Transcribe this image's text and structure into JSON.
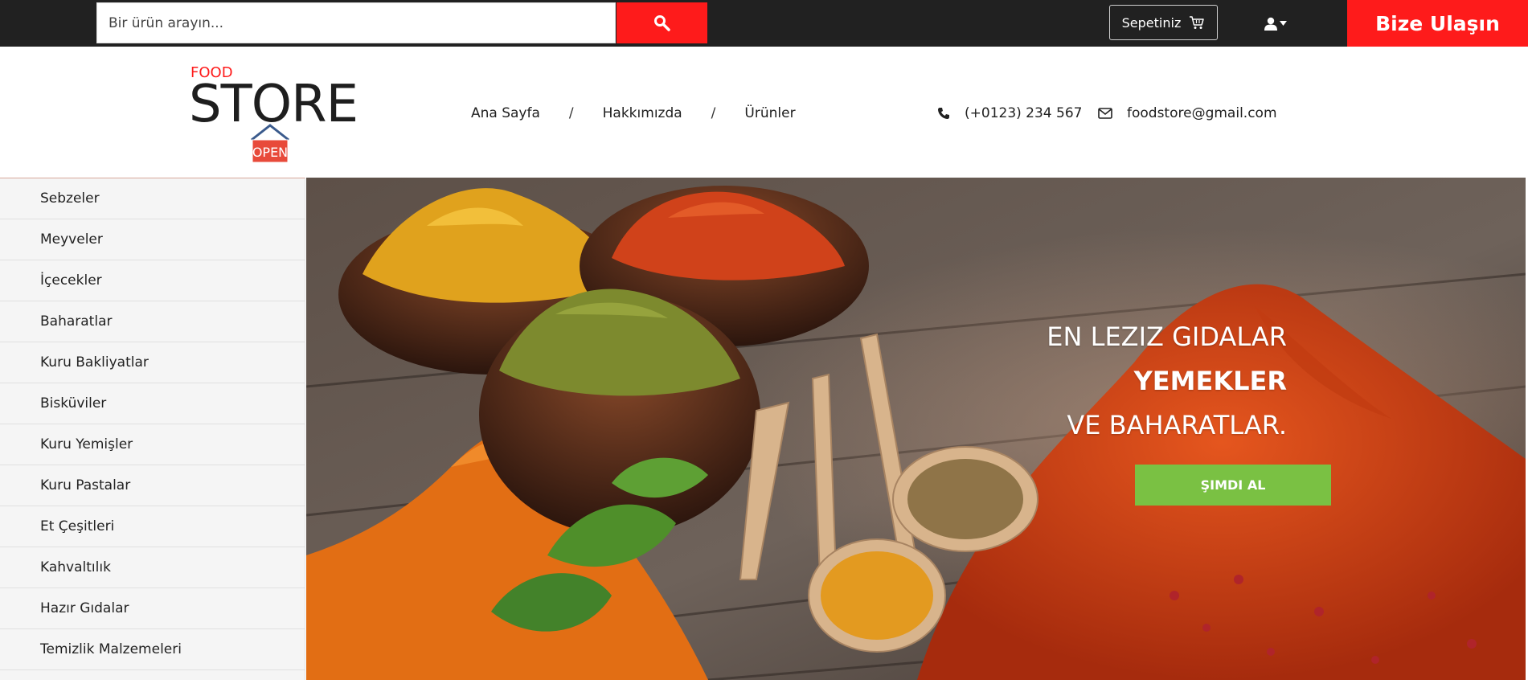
{
  "topbar": {
    "search": {
      "placeholder": "Bir ürün arayın...",
      "value": ""
    },
    "search_button_icon": "search-icon",
    "cart_label": "Sepetiniz",
    "cart_icon": "cart-icon",
    "user_icon": "user-icon",
    "contact_label": "Bize Ulaşın"
  },
  "logo": {
    "top_text": "FOOD",
    "main_text": "STORE",
    "sign_text": "OPEN"
  },
  "nav": {
    "items": [
      {
        "label": "Ana Sayfa"
      },
      {
        "label": "Hakkımızda"
      },
      {
        "label": "Ürünler"
      }
    ],
    "separator": "/"
  },
  "contact": {
    "phone": "(+0123) 234 567",
    "email": "foodstore@gmail.com"
  },
  "sidebar": {
    "items": [
      {
        "label": "Sebzeler"
      },
      {
        "label": "Meyveler"
      },
      {
        "label": "İçecekler"
      },
      {
        "label": "Baharatlar"
      },
      {
        "label": "Kuru Bakliyatlar"
      },
      {
        "label": "Bisküviler"
      },
      {
        "label": "Kuru Yemişler"
      },
      {
        "label": "Kuru Pastalar"
      },
      {
        "label": "Et Çeşitleri"
      },
      {
        "label": "Kahvaltılık"
      },
      {
        "label": "Hazır Gıdalar"
      },
      {
        "label": "Temizlik Malzemeleri"
      }
    ]
  },
  "hero": {
    "line1": "EN LEZIZ GIDALAR",
    "line2": "YEMEKLER",
    "line3": "VE BAHARATLAR.",
    "button_label": "ŞIMDI AL"
  },
  "colors": {
    "topbar_bg": "#212121",
    "accent_red": "#fe1b1b",
    "cta_green": "#7ac143",
    "sidebar_bg": "#f5f5f5"
  }
}
